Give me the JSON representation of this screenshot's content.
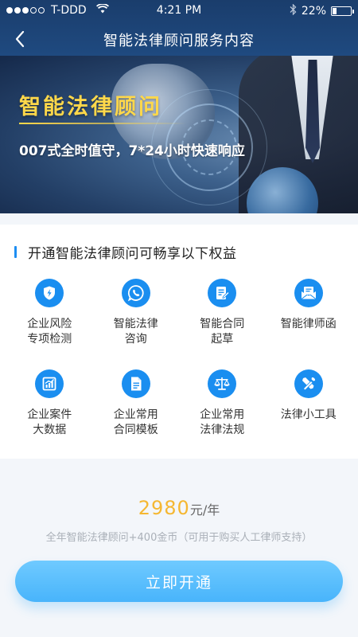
{
  "status_bar": {
    "carrier": "T-DDD",
    "time": "4:21 PM",
    "battery": "22%",
    "battery_level": 0.22
  },
  "nav": {
    "back_icon": "chevron-left-icon",
    "title": "智能法律顾问服务内容"
  },
  "banner": {
    "title": "智能法律顾问",
    "subtitle": "007式全时值守，7*24小时快速响应"
  },
  "benefits": {
    "title": "开通智能法律顾问可畅享以下权益",
    "items": [
      {
        "label": "企业风险\n专项检测",
        "icon": "shield-icon"
      },
      {
        "label": "智能法律\n咨询",
        "icon": "phone-chat-icon"
      },
      {
        "label": "智能合同\n起草",
        "icon": "document-edit-icon"
      },
      {
        "label": "智能律师函",
        "icon": "mail-letter-icon"
      },
      {
        "label": "企业案件\n大数据",
        "icon": "bar-chart-icon"
      },
      {
        "label": "企业常用\n合同模板",
        "icon": "document-icon"
      },
      {
        "label": "企业常用\n法律法规",
        "icon": "scales-icon"
      },
      {
        "label": "法律小工具",
        "icon": "tools-icon"
      }
    ]
  },
  "pricing": {
    "amount": "2980",
    "unit": "元/年",
    "description": "全年智能法律顾问+400金币（可用于购买人工律师支持）"
  },
  "cta": {
    "label": "立即开通"
  },
  "colors": {
    "accent": "#1a8ef0",
    "price": "#f5b731",
    "banner_title": "#ffd84a",
    "button": "#48b4fb",
    "nav_bg": "#1f4a80"
  }
}
